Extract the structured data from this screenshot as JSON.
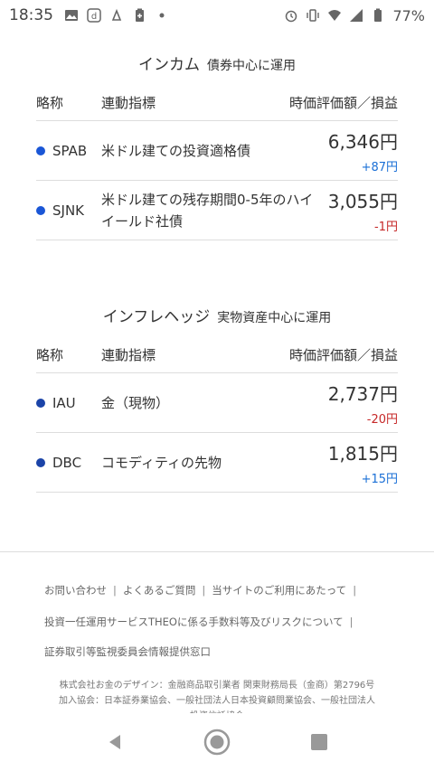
{
  "status_bar": {
    "time": "18:35",
    "battery": "77%"
  },
  "sections": [
    {
      "title": "インカム",
      "subtitle": "債券中心に運用",
      "headers": {
        "name": "略称",
        "index": "連動指標",
        "value": "時価評価額／損益"
      },
      "rows": [
        {
          "name": "SPAB",
          "index": "米ドル建ての投資適格債",
          "amount": "6,346円",
          "pl": "+87円",
          "pl_sign": "pos"
        },
        {
          "name": "SJNK",
          "index": "米ドル建ての残存期間0-5年のハイイールド社債",
          "amount": "3,055円",
          "pl": "-1円",
          "pl_sign": "neg"
        }
      ]
    },
    {
      "title": "インフレヘッジ",
      "subtitle": "実物資産中心に運用",
      "headers": {
        "name": "略称",
        "index": "連動指標",
        "value": "時価評価額／損益"
      },
      "rows": [
        {
          "name": "IAU",
          "index": "金（現物）",
          "amount": "2,737円",
          "pl": "-20円",
          "pl_sign": "neg"
        },
        {
          "name": "DBC",
          "index": "コモディティの先物",
          "amount": "1,815円",
          "pl": "+15円",
          "pl_sign": "pos"
        }
      ]
    }
  ],
  "footer": {
    "link_contact": "お問い合わせ",
    "link_faq": "よくあるご質問",
    "link_terms": "当サイトのご利用にあたって",
    "link_fees": "投資一任運用サービスTHEOに係る手数料等及びリスクについて",
    "link_sesc": "証券取引等監視委員会情報提供窓口",
    "separator": "|",
    "company_line1": "株式会社お金のデザイン：金融商品取引業者 関東財務局長（金商）第2796号",
    "company_line2": "加入協会：日本証券業協会、一般社団法人日本投資顧問業協会、一般社団法人",
    "company_line3": "投資信託協会"
  },
  "colors": {
    "positive": "#1a6fd6",
    "negative": "#c62828",
    "dot": "#1a56d6"
  }
}
